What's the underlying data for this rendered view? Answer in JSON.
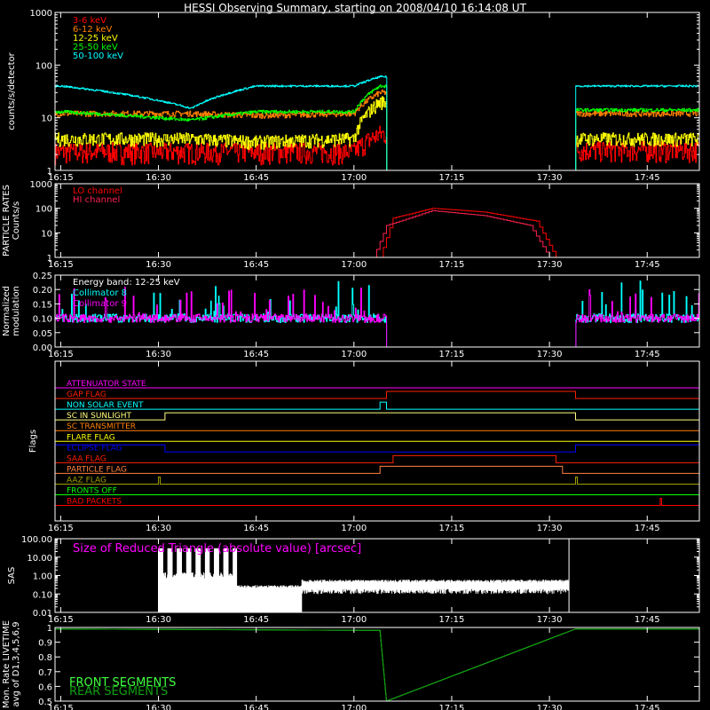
{
  "title": "HESSI Observing Summary, starting on 2008/04/10 16:14:08 UT",
  "x_ticks": [
    "16:15",
    "16:30",
    "16:45",
    "17:00",
    "17:15",
    "17:30",
    "17:45"
  ],
  "chart_data": [
    {
      "type": "line",
      "id": "countrates",
      "ylabel": "counts/s/detector",
      "yscale": "log",
      "ylim": [
        1,
        1000
      ],
      "yticks": [
        "1",
        "10",
        "100",
        "1000"
      ],
      "series": [
        {
          "name": "3-6 keV",
          "color": "#ff0000",
          "x": [
            "16:15",
            "16:35",
            "16:45",
            "17:00",
            "17:04",
            "17:05",
            "17:34",
            "17:50"
          ],
          "values": [
            2.3,
            2.3,
            2.3,
            2.3,
            5,
            null,
            2.5,
            2.5
          ]
        },
        {
          "name": "6-12 keV",
          "color": "#ff7f00",
          "x": [
            "16:15",
            "16:35",
            "16:45",
            "17:00",
            "17:04",
            "17:05",
            "17:34",
            "17:50"
          ],
          "values": [
            12,
            12,
            11,
            12,
            30,
            null,
            12,
            12
          ]
        },
        {
          "name": "12-25 keV",
          "color": "#ffff00",
          "x": [
            "16:15",
            "16:35",
            "16:45",
            "17:00",
            "17:04",
            "17:05",
            "17:34",
            "17:50"
          ],
          "values": [
            4,
            4,
            3.5,
            4,
            20,
            null,
            4,
            4
          ]
        },
        {
          "name": "25-50 keV",
          "color": "#00ff00",
          "x": [
            "16:15",
            "16:35",
            "16:45",
            "17:00",
            "17:04",
            "17:05",
            "17:34",
            "17:50"
          ],
          "values": [
            13,
            9,
            13,
            13,
            40,
            null,
            14,
            14
          ]
        },
        {
          "name": "50-100 keV",
          "color": "#00ffff",
          "x": [
            "16:15",
            "16:35",
            "16:45",
            "17:00",
            "17:04",
            "17:05",
            "17:34",
            "17:50"
          ],
          "values": [
            40,
            15,
            40,
            40,
            60,
            null,
            40,
            40
          ]
        }
      ]
    },
    {
      "type": "line",
      "id": "particle",
      "ylabel": "PARTICLE RATES",
      "ylabel2": "Counts/s",
      "yscale": "log",
      "ylim": [
        1,
        1000
      ],
      "yticks": [
        "1",
        "10",
        "100",
        "1000"
      ],
      "series": [
        {
          "name": "LO channel",
          "color": "#ff0000",
          "x": [
            "17:04",
            "17:06",
            "17:12",
            "17:20",
            "17:28",
            "17:31"
          ],
          "values": [
            1,
            40,
            100,
            70,
            30,
            1
          ]
        },
        {
          "name": "HI channel",
          "color": "#ff2050",
          "x": [
            "17:03",
            "17:05",
            "17:12",
            "17:20",
            "17:27",
            "17:30"
          ],
          "values": [
            1,
            20,
            80,
            50,
            20,
            1
          ]
        }
      ]
    },
    {
      "type": "line",
      "id": "modulation",
      "ylabel": "Normalized",
      "ylabel2": "modulation",
      "ylim": [
        0,
        0.25
      ],
      "yticks": [
        "0.00",
        "0.05",
        "0.10",
        "0.15",
        "0.20",
        "0.25"
      ],
      "annotation": "Energy band: 12-25 keV",
      "series": [
        {
          "name": "Collimator 8",
          "color": "#00ffff",
          "x": [
            "16:15",
            "17:05",
            "17:34",
            "17:50"
          ],
          "values": [
            0.1,
            0.1,
            0.1,
            0.1
          ]
        },
        {
          "name": "Collimator 9",
          "color": "#ff00ff",
          "x": [
            "16:15",
            "17:05",
            "17:34",
            "17:50"
          ],
          "values": [
            0.1,
            0.1,
            0.1,
            0.1
          ]
        }
      ]
    },
    {
      "type": "line",
      "id": "flags",
      "ylabel": "Flags",
      "series": [
        {
          "name": "ATTENUATOR STATE",
          "color": "#ff00ff",
          "x": [
            "16:15",
            "17:50"
          ],
          "values": [
            0,
            0
          ]
        },
        {
          "name": "GAP FLAG",
          "color": "#ff2000",
          "x": [
            "16:15",
            "17:05",
            "17:34",
            "17:50"
          ],
          "values": [
            0,
            1,
            0,
            0
          ]
        },
        {
          "name": "NON SOLAR EVENT",
          "color": "#00ffff",
          "x": [
            "16:15",
            "17:04",
            "17:05",
            "17:50"
          ],
          "values": [
            0,
            1,
            0,
            0
          ]
        },
        {
          "name": "SC IN SUNLIGHT",
          "color": "#ffff80",
          "x": [
            "16:15",
            "16:31",
            "17:34",
            "17:50"
          ],
          "values": [
            0,
            1,
            0,
            0
          ]
        },
        {
          "name": "SC TRANSMITTER",
          "color": "#ff8000",
          "x": [
            "16:15",
            "17:50"
          ],
          "values": [
            0,
            0
          ]
        },
        {
          "name": "FLARE FLAG",
          "color": "#ffff00",
          "x": [
            "16:15",
            "17:50"
          ],
          "values": [
            0,
            0
          ]
        },
        {
          "name": "ECLIPSE FLAG",
          "color": "#0000ff",
          "x": [
            "16:15",
            "16:31",
            "17:34",
            "17:50"
          ],
          "values": [
            1,
            0,
            1,
            1
          ]
        },
        {
          "name": "SAA FLAG",
          "color": "#ff2000",
          "x": [
            "16:15",
            "17:06",
            "17:31",
            "17:50"
          ],
          "values": [
            0,
            1,
            0,
            0
          ]
        },
        {
          "name": "PARTICLE FLAG",
          "color": "#ff8040",
          "x": [
            "16:15",
            "17:04",
            "17:32",
            "17:50"
          ],
          "values": [
            0,
            1,
            0,
            0
          ]
        },
        {
          "name": "AAZ FLAG",
          "color": "#a0a000",
          "x": [
            "16:15",
            "16:30",
            "17:34",
            "17:50"
          ],
          "values": [
            0,
            1,
            1,
            0
          ]
        },
        {
          "name": "FRONTS OFF",
          "color": "#00ff00",
          "x": [
            "16:15",
            "17:50"
          ],
          "values": [
            0,
            0
          ]
        },
        {
          "name": "BAD PACKETS",
          "color": "#ff0000",
          "x": [
            "16:15",
            "17:47",
            "17:50"
          ],
          "values": [
            0,
            1,
            0
          ]
        }
      ]
    },
    {
      "type": "line",
      "id": "sas",
      "ylabel": "SAS",
      "yscale": "log",
      "ylim": [
        0.01,
        100
      ],
      "yticks": [
        "0.01",
        "0.10",
        "1.00",
        "10.00",
        "100.00"
      ],
      "annotation": "Size of Reduced Triangle (absolute value) [arcsec]",
      "series": [
        {
          "name": "",
          "color": "#ffffff",
          "x": [
            "16:30",
            "16:40",
            "16:48",
            "17:00",
            "17:30",
            "17:33"
          ],
          "values": [
            1,
            0.3,
            0.2,
            0.5,
            0.6,
            100
          ]
        }
      ]
    },
    {
      "type": "line",
      "id": "livetime",
      "ylabel": "Mon. Rate LIVETIME",
      "ylabel2": "avg of D1,3,4,5,6,9",
      "ylim": [
        0.5,
        1.0
      ],
      "yticks": [
        "0.5",
        "0.6",
        "0.7",
        "0.8",
        "0.9",
        "1"
      ],
      "series": [
        {
          "name": "FRONT SEGMENTS",
          "color": "#40ff40",
          "x": [
            "16:15",
            "17:04",
            "17:05",
            "17:34",
            "17:50"
          ],
          "values": [
            0.99,
            0.98,
            0.5,
            0.99,
            0.99
          ]
        },
        {
          "name": "REAR SEGMENTS",
          "color": "#10a010",
          "x": [
            "16:15",
            "17:04",
            "17:05",
            "17:34",
            "17:50"
          ],
          "values": [
            0.99,
            0.98,
            0.5,
            0.99,
            0.99
          ]
        }
      ]
    }
  ]
}
